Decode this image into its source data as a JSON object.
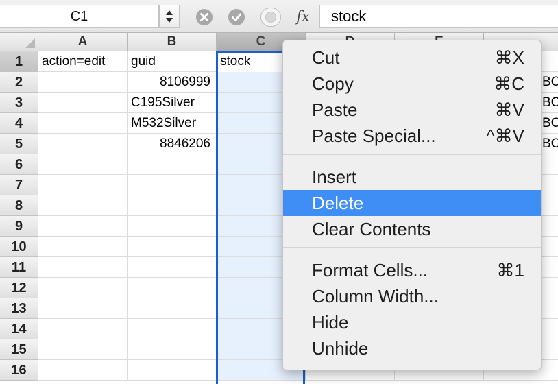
{
  "formula_bar": {
    "name_box": "C1",
    "formula": "stock",
    "fx_label": "fx"
  },
  "columns": [
    "A",
    "B",
    "C",
    "D",
    "E"
  ],
  "selected_column": "C",
  "rows": [
    "1",
    "2",
    "3",
    "4",
    "5",
    "6",
    "7",
    "8",
    "9",
    "10",
    "11",
    "12",
    "13",
    "14",
    "15",
    "16"
  ],
  "cells": {
    "A1": "action=edit",
    "B1": "guid",
    "C1": "stock",
    "B2": "8106999",
    "B3": "C195Silver",
    "B4": "M532Silver",
    "B5": "8846206",
    "G2": "BC",
    "G3": "BC",
    "G4": "BC",
    "G5": "BC"
  },
  "context_menu": {
    "groups": [
      [
        {
          "label": "Cut",
          "shortcut": "⌘X"
        },
        {
          "label": "Copy",
          "shortcut": "⌘C"
        },
        {
          "label": "Paste",
          "shortcut": "⌘V"
        },
        {
          "label": "Paste Special...",
          "shortcut": "^⌘V"
        }
      ],
      [
        {
          "label": "Insert",
          "shortcut": ""
        },
        {
          "label": "Delete",
          "shortcut": "",
          "highlighted": true
        },
        {
          "label": "Clear Contents",
          "shortcut": ""
        }
      ],
      [
        {
          "label": "Format Cells...",
          "shortcut": "⌘1"
        },
        {
          "label": "Column Width...",
          "shortcut": ""
        },
        {
          "label": "Hide",
          "shortcut": ""
        },
        {
          "label": "Unhide",
          "shortcut": ""
        }
      ]
    ]
  },
  "colors": {
    "selection_border": "#1a5ed0",
    "selection_fill": "#e6f1fd",
    "menu_highlight": "#3f8ef5"
  }
}
